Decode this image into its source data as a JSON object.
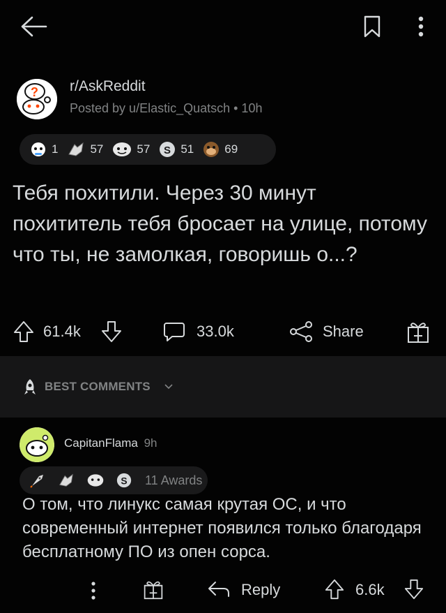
{
  "header": {
    "back_icon": "arrow-left-icon",
    "save_icon": "bookmark-icon",
    "more_icon": "vertical-dots-icon"
  },
  "post": {
    "subreddit": "r/AskReddit",
    "meta": "Posted by u/Elastic_Quatsch • 10h",
    "awards": [
      {
        "icon": "award-ice-icon",
        "count": "1"
      },
      {
        "icon": "award-hands-icon",
        "count": "57"
      },
      {
        "icon": "award-face-icon",
        "count": "57"
      },
      {
        "icon": "award-silver-icon",
        "count": "51"
      },
      {
        "icon": "award-monkey-icon",
        "count": "69"
      }
    ],
    "title": "Тебя похитили. Через 30 минут похититель тебя бросает на улице, потому что ты, не замолкая, говоришь о...?",
    "upvotes": "61.4k",
    "comments": "33.0k",
    "share_label": "Share"
  },
  "sort": {
    "label": "BEST COMMENTS"
  },
  "comment": {
    "author": "CapitanFlama",
    "time": "9h",
    "awards_label": "11 Awards",
    "body": "О том, что линукс самая крутая ОС, и что современный интернет появился только благодаря бесплатному ПО из опен сорса.",
    "reply_label": "Reply",
    "votes": "6.6k"
  },
  "colors": {
    "background": "#030303",
    "divider": "#161617",
    "text": "#d7dadc",
    "muted": "#818384"
  }
}
